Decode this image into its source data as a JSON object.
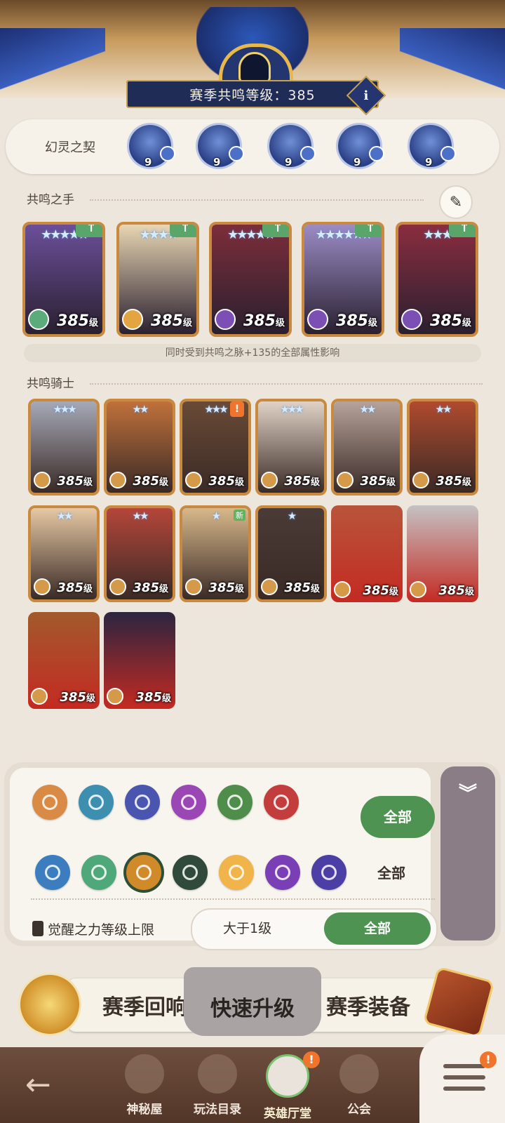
{
  "header": {
    "season_level_label": "赛季共鸣等级：385",
    "info_icon": "i"
  },
  "phantom_contract": {
    "title": "幻灵之契",
    "spirits": [
      {
        "level": "9",
        "icon": "spirit-mustache-icon",
        "badge": "plus"
      },
      {
        "level": "9",
        "icon": "spirit-creature-icon",
        "badge": "leaf"
      },
      {
        "level": "9",
        "icon": "spirit-owl-icon",
        "badge": "sun"
      },
      {
        "level": "9",
        "icon": "spirit-beast-icon",
        "badge": "eye"
      },
      {
        "level": "9",
        "icon": "spirit-horned-icon",
        "badge": "gem"
      }
    ]
  },
  "resonance_hands": {
    "title": "共鸣之手",
    "note": "同时受到共鸣之脉+135的全部属性影响",
    "heroes": [
      {
        "stars": "★★★★★",
        "level": "385",
        "unit": "级",
        "faction_color": "#5bab7b",
        "bg": "#6b4f9a"
      },
      {
        "stars": "★★★★",
        "level": "385",
        "unit": "级",
        "faction_color": "#e3a542",
        "bg": "#e8d6b3"
      },
      {
        "stars": "★★★★★",
        "level": "385",
        "unit": "级",
        "faction_color": "#7b4fb3",
        "bg": "#7d2d3a"
      },
      {
        "stars": "★★★★★★",
        "level": "385",
        "unit": "级",
        "faction_color": "#7b4fb3",
        "bg": "#9b8cc5"
      },
      {
        "stars": "★★★",
        "level": "385",
        "unit": "级",
        "faction_color": "#7b4fb3",
        "bg": "#8a2d3f"
      }
    ]
  },
  "resonance_knights": {
    "title": "共鸣骑士",
    "heroes": [
      {
        "stars": "★★★",
        "level": "385",
        "unit": "级",
        "bg": "#a6a9b7",
        "badge": ""
      },
      {
        "stars": "★★",
        "level": "385",
        "unit": "级",
        "bg": "#c0713b",
        "badge": ""
      },
      {
        "stars": "★★★",
        "level": "385",
        "unit": "级",
        "bg": "#6a4a36",
        "badge": "!"
      },
      {
        "stars": "★★★",
        "level": "385",
        "unit": "级",
        "bg": "#e0d3c6",
        "badge": ""
      },
      {
        "stars": "★★",
        "level": "385",
        "unit": "级",
        "bg": "#b6a39a",
        "badge": ""
      },
      {
        "stars": "★★",
        "level": "385",
        "unit": "级",
        "bg": "#b04a2e",
        "badge": ""
      },
      {
        "stars": "★★",
        "level": "385",
        "unit": "级",
        "bg": "#e6c9a4",
        "badge": ""
      },
      {
        "stars": "★★",
        "level": "385",
        "unit": "级",
        "bg": "#b5463a",
        "badge": ""
      },
      {
        "stars": "★",
        "level": "385",
        "unit": "级",
        "bg": "#d8b88b",
        "badge": "新"
      },
      {
        "stars": "★",
        "level": "385",
        "unit": "级",
        "bg": "#4a3b36",
        "badge": ""
      },
      {
        "stars": "",
        "level": "385",
        "unit": "级",
        "bg": "#b8553a",
        "badge": ""
      },
      {
        "stars": "",
        "level": "385",
        "unit": "级",
        "bg": "#c5c2c4",
        "badge": ""
      },
      {
        "stars": "",
        "level": "385",
        "unit": "级",
        "bg": "#a25a2c",
        "badge": ""
      },
      {
        "stars": "",
        "level": "385",
        "unit": "级",
        "bg": "#2b2540",
        "badge": ""
      }
    ]
  },
  "filters": {
    "class_icons": [
      {
        "name": "tank-class-icon",
        "color": "#d98b46"
      },
      {
        "name": "mage-class-icon",
        "color": "#3d8fb0"
      },
      {
        "name": "archer-class-icon",
        "color": "#4a55b0"
      },
      {
        "name": "support-class-icon",
        "color": "#9a47b5"
      },
      {
        "name": "assassin-class-icon",
        "color": "#4f8d4a"
      },
      {
        "name": "warrior-class-icon",
        "color": "#c43d3d"
      }
    ],
    "class_all_label": "全部",
    "faction_icons": [
      {
        "name": "lightbearer-faction-icon",
        "color": "#3c7dc0"
      },
      {
        "name": "wilder-faction-icon",
        "color": "#4fa87a"
      },
      {
        "name": "graveborn-faction-icon",
        "color": "#d08a2a"
      },
      {
        "name": "mauler-faction-icon",
        "color": "#2f4a3a"
      },
      {
        "name": "celestial-faction-icon",
        "color": "#f0b44a"
      },
      {
        "name": "hypogean-faction-icon",
        "color": "#7b3fb5"
      },
      {
        "name": "dimensional-faction-icon",
        "color": "#4b3fa5"
      }
    ],
    "faction_all_label": "全部",
    "awaken_label": "觉醒之力等级上限",
    "awaken_value": "大于1级",
    "awaken_all_label": "全部"
  },
  "action_tabs": {
    "echo": "赛季回响",
    "quick": "快速升级",
    "equip": "赛季装备"
  },
  "bottom_nav": {
    "items": [
      {
        "label": "神秘屋"
      },
      {
        "label": "玩法目录"
      },
      {
        "label": "英雄厅堂"
      },
      {
        "label": "公会"
      }
    ],
    "alert": "!"
  }
}
